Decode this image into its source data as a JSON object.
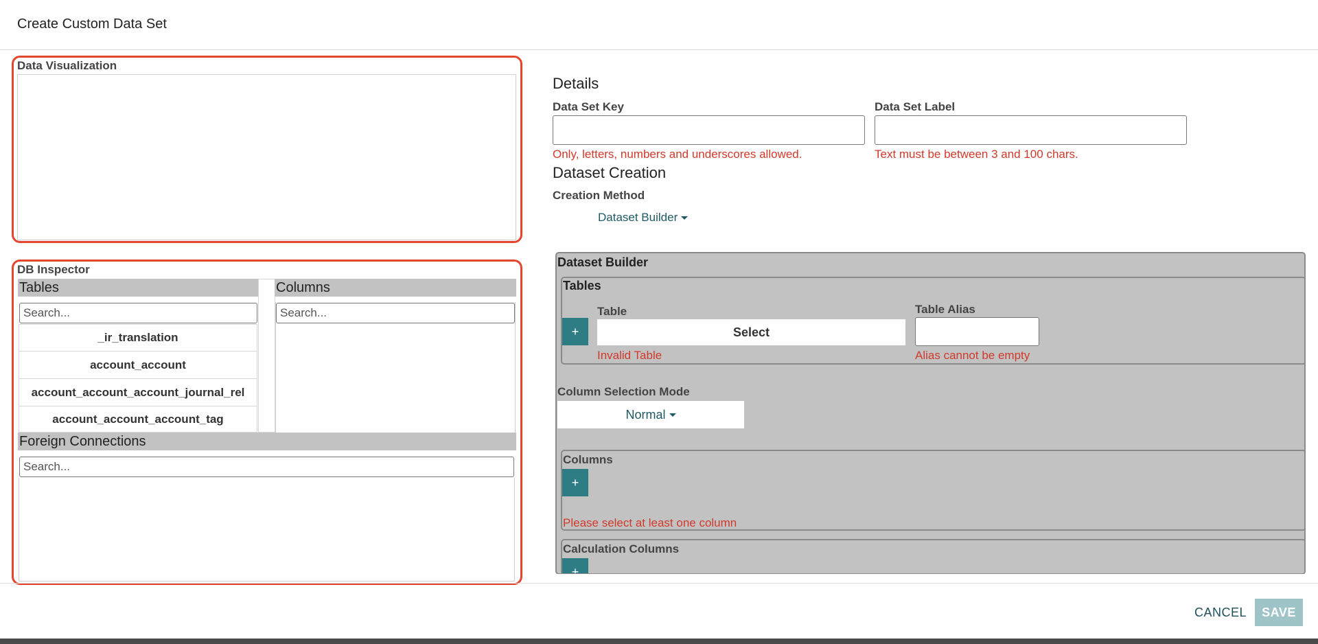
{
  "header": {
    "title": "Create Custom Data Set"
  },
  "visualization": {
    "label": "Data Visualization"
  },
  "inspector": {
    "label": "DB Inspector",
    "tables_header": "Tables",
    "columns_header": "Columns",
    "tables_search_placeholder": "Search...",
    "columns_search_placeholder": "Search...",
    "tables": [
      "_ir_translation",
      "account_account",
      "account_account_account_journal_rel",
      "account_account_account_tag"
    ],
    "foreign_header": "Foreign Connections",
    "foreign_search_placeholder": "Search..."
  },
  "details": {
    "title": "Details",
    "key_label": "Data Set Key",
    "key_error": "Only, letters, numbers and underscores allowed.",
    "label_label": "Data Set Label",
    "label_error": "Text must be between 3 and 100 chars."
  },
  "creation": {
    "title": "Dataset Creation",
    "method_label": "Creation Method",
    "method_value": "Dataset Builder"
  },
  "builder": {
    "title": "Dataset Builder",
    "tables_title": "Tables",
    "table_label": "Table",
    "table_select": "Select",
    "table_error": "Invalid Table",
    "alias_label": "Table Alias",
    "alias_error": "Alias cannot be empty",
    "add_symbol": "+",
    "mode_label": "Column Selection Mode",
    "mode_value": "Normal",
    "columns_title": "Columns",
    "columns_error": "Please select at least one column",
    "calc_title": "Calculation Columns"
  },
  "footer": {
    "cancel": "CANCEL",
    "save": "SAVE"
  },
  "colors": {
    "accent": "#2e7c84",
    "error": "#d1392b",
    "highlight": "#e5452f",
    "panel": "#c2c2c2"
  }
}
